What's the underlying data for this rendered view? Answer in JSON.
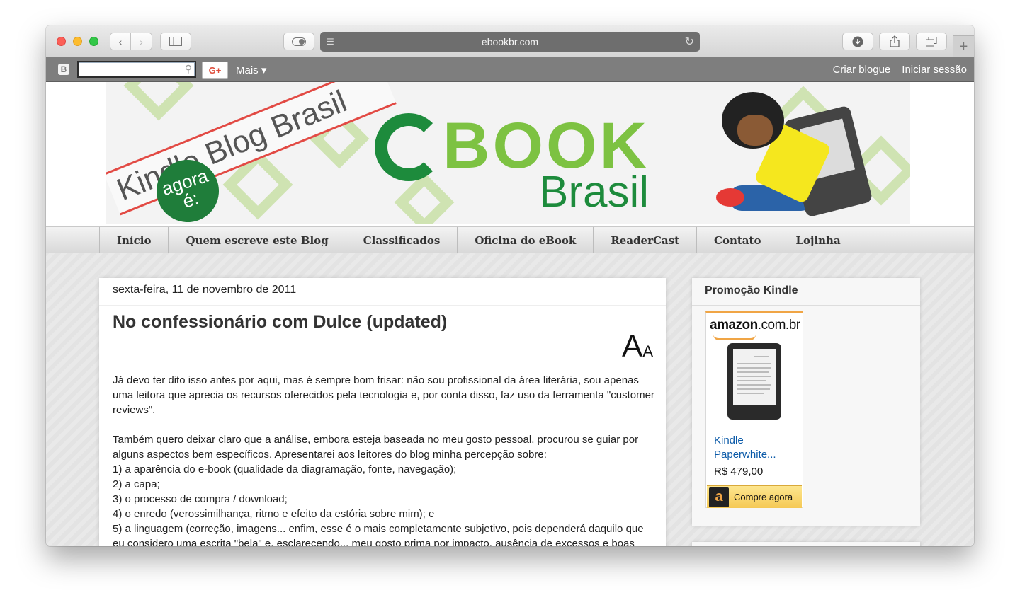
{
  "browser": {
    "url": "ebookbr.com",
    "back_icon": "chevron-left-icon",
    "forward_icon": "chevron-right-icon",
    "new_tab_label": "+"
  },
  "blogger_bar": {
    "search_placeholder": "",
    "gplus_label": "G+",
    "more_label": "Mais ▾",
    "create_blog": "Criar blogue",
    "sign_in": "Iniciar sessão"
  },
  "header": {
    "banner_tagline": "Kindle Blog Brasil",
    "banner_badge": "agora é:",
    "logo_book": "BOOK",
    "logo_brasil": "Brasil"
  },
  "nav": {
    "tabs": [
      {
        "label": "Início"
      },
      {
        "label": "Quem escreve este Blog"
      },
      {
        "label": "Classificados"
      },
      {
        "label": "Oficina do eBook"
      },
      {
        "label": "ReaderCast"
      },
      {
        "label": "Contato"
      },
      {
        "label": "Lojinha"
      }
    ]
  },
  "post": {
    "date": "sexta-feira, 11 de novembro de 2011",
    "title": "No confessionário com Dulce (updated)",
    "font_big": "A",
    "font_small": "A",
    "paragraph1": "Já devo ter dito isso antes por aqui, mas é sempre bom frisar: não sou profissional da área literária, sou apenas uma leitora que aprecia os recursos oferecidos pela tecnologia e, por conta disso, faz uso da ferramenta \"customer reviews\".",
    "paragraph2_lines": [
      "Também quero deixar claro que a análise, embora esteja baseada no meu gosto pessoal, procurou se guiar por alguns aspectos bem específicos. Apresentarei aos leitores do blog minha percepção sobre:",
      "1) a aparência do e-book (qualidade da diagramação, fonte, navegação);",
      "2) a capa;",
      "3) o processo de compra / download;",
      "4) o enredo (verossimilhança, ritmo e efeito da estória sobre mim); e",
      "5) a linguagem (correção, imagens... enfim, esse é o mais completamente subjetivo, pois dependerá daquilo que eu considero uma escrita \"bela\" e, esclarecendo... meu gosto prima por impacto, ausência de excessos e boas"
    ]
  },
  "sidebar": {
    "widget_title": "Promoção Kindle",
    "amazon_logo_main": "amazon",
    "amazon_logo_domain": ".com.br",
    "product_name": "Kindle Paperwhite...",
    "product_price": "R$ 479,00",
    "buy_label": "Compre agora"
  }
}
